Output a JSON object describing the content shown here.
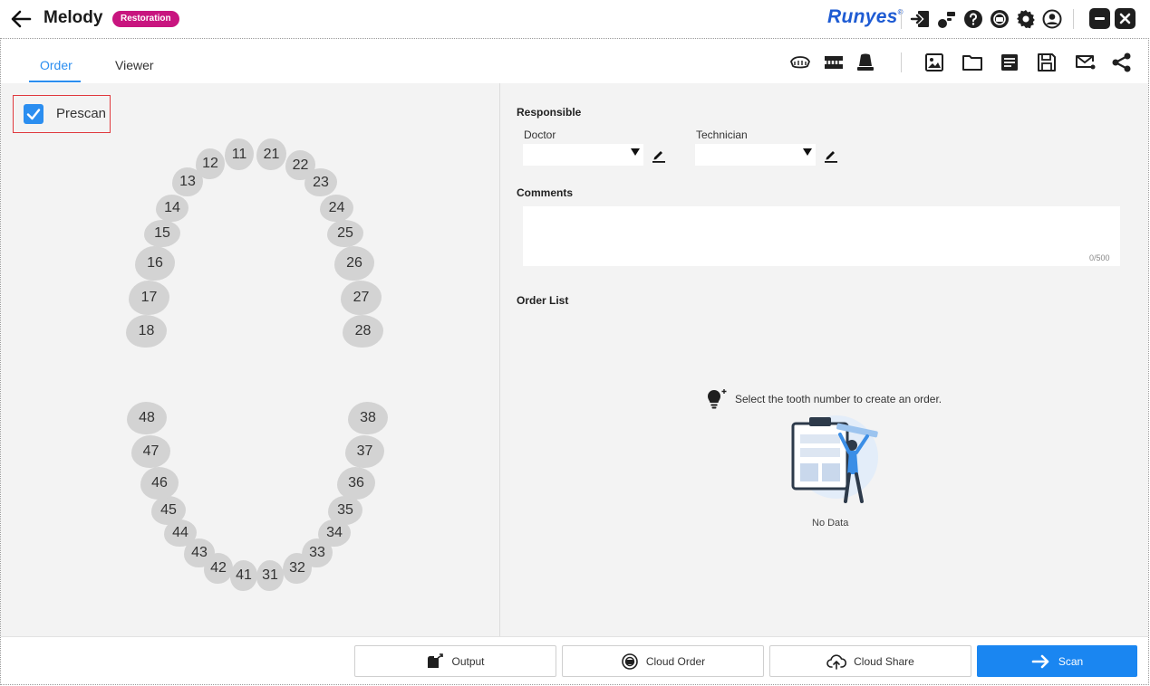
{
  "header": {
    "title": "Melody",
    "badge": "Restoration",
    "brand": "Runyes",
    "brand_mark": "®",
    "icons": [
      "exit-icon",
      "device-icon",
      "help-icon",
      "plugin-icon",
      "settings-icon",
      "account-icon"
    ],
    "window_controls": [
      "minimize-icon",
      "close-icon"
    ]
  },
  "tabs": [
    {
      "label": "Order",
      "active": true
    },
    {
      "label": "Viewer",
      "active": false
    }
  ],
  "toolbar_icons": [
    "upper-jaw-icon",
    "bite-icon",
    "die-icon",
    "image-icon",
    "folder-icon",
    "document-icon",
    "save-icon",
    "mail-icon",
    "share-icon"
  ],
  "prescan": {
    "label": "Prescan",
    "checked": true
  },
  "teeth": {
    "upper": [
      "11",
      "12",
      "13",
      "14",
      "15",
      "16",
      "17",
      "18",
      "21",
      "22",
      "23",
      "24",
      "25",
      "26",
      "27",
      "28"
    ],
    "lower": [
      "31",
      "32",
      "33",
      "34",
      "35",
      "36",
      "37",
      "38",
      "41",
      "42",
      "43",
      "44",
      "45",
      "46",
      "47",
      "48"
    ]
  },
  "responsible": {
    "title": "Responsible",
    "doctor_label": "Doctor",
    "technician_label": "Technician"
  },
  "comments": {
    "title": "Comments",
    "counter": "0/500"
  },
  "order_list": {
    "title": "Order List",
    "hint": "Select the tooth number to create an order.",
    "empty": "No Data"
  },
  "footer": {
    "output": "Output",
    "cloud_order": "Cloud Order",
    "cloud_share": "Cloud Share",
    "scan": "Scan"
  },
  "colors": {
    "accent": "#1a86f1",
    "badge": "#c8157f",
    "brand": "#1e5bd3",
    "highlight": "#e0393e"
  }
}
